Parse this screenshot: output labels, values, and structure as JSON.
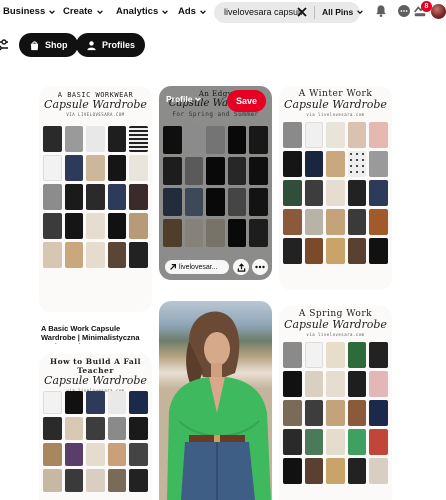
{
  "nav": {
    "items": [
      {
        "label": "Business"
      },
      {
        "label": "Create"
      },
      {
        "label": "Analytics"
      },
      {
        "label": "Ads"
      }
    ],
    "search_value": "livelovesara capsule",
    "search_scope": "All Pins",
    "notifications_count": "8"
  },
  "filters": {
    "shop": "Shop",
    "profiles": "Profiles"
  },
  "pins": {
    "p1": {
      "kicker": "A BASIC WORKWEAR",
      "title": "Capsule Wardrobe",
      "sub": "VIA LIVELOVESARA.COM",
      "caption": "A Basic Work Capsule Wardrobe | Minimalistyczna moda, Moda,..."
    },
    "p2": {
      "kicker": "An Edgy",
      "title": "Capsule Wardrobe",
      "sub": "For Spring and Summer",
      "profile_label": "Profile",
      "save_label": "Save",
      "link_label": "livelovesar..."
    },
    "p3": {
      "kicker": "A Winter Work",
      "title": "Capsule Wardrobe",
      "sub": "via livelovesara.com"
    },
    "p5": {
      "kicker": "How to Build A Fall Teacher",
      "title": "Capsule Wardrobe",
      "sub": "via livelovesara.com"
    },
    "p6": {
      "kicker": "A Spring Work",
      "title": "Capsule Wardrobe",
      "sub": "via livelovesara.com"
    }
  },
  "colors": {
    "accent": "#e60023",
    "chip": "#111111",
    "search_bg": "#e9e9e9"
  }
}
